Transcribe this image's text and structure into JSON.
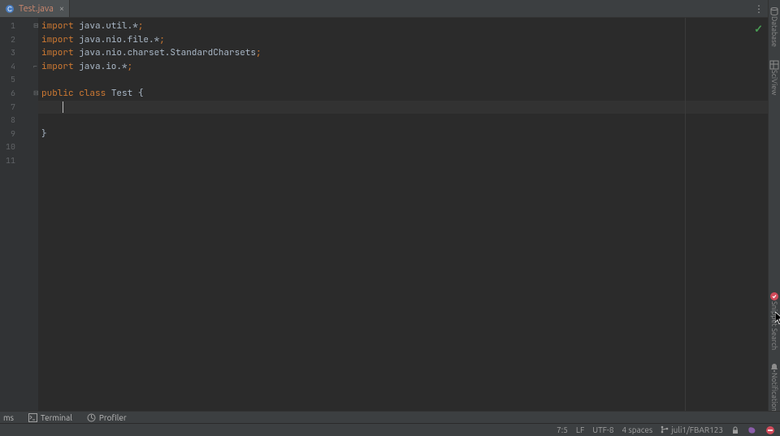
{
  "tab": {
    "filename": "Test.java",
    "close_glyph": "×"
  },
  "editor": {
    "line_numbers": [
      "1",
      "2",
      "3",
      "4",
      "5",
      "6",
      "7",
      "8",
      "9",
      "10",
      "11"
    ],
    "lines": [
      {
        "tokens": [
          {
            "t": "import ",
            "c": "kw"
          },
          {
            "t": "java.util.*",
            "c": "plain"
          },
          {
            "t": ";",
            "c": "semi"
          }
        ]
      },
      {
        "tokens": [
          {
            "t": "import ",
            "c": "kw"
          },
          {
            "t": "java.nio.file.*",
            "c": "plain"
          },
          {
            "t": ";",
            "c": "semi"
          }
        ]
      },
      {
        "tokens": [
          {
            "t": "import ",
            "c": "kw"
          },
          {
            "t": "java.nio.charset.StandardCharsets",
            "c": "plain"
          },
          {
            "t": ";",
            "c": "semi"
          }
        ]
      },
      {
        "tokens": [
          {
            "t": "import ",
            "c": "kw"
          },
          {
            "t": "java.io.*",
            "c": "plain"
          },
          {
            "t": ";",
            "c": "semi"
          }
        ]
      },
      {
        "tokens": [
          {
            "t": "",
            "c": "plain"
          }
        ]
      },
      {
        "tokens": [
          {
            "t": "public class ",
            "c": "kw"
          },
          {
            "t": "Test ",
            "c": "plain"
          },
          {
            "t": "{",
            "c": "plain"
          }
        ]
      },
      {
        "tokens": [
          {
            "t": "    ",
            "c": "plain"
          }
        ]
      },
      {
        "tokens": [
          {
            "t": "",
            "c": "plain"
          }
        ]
      },
      {
        "tokens": [
          {
            "t": "}",
            "c": "plain"
          }
        ]
      },
      {
        "tokens": [
          {
            "t": "",
            "c": "plain"
          }
        ]
      },
      {
        "tokens": [
          {
            "t": "",
            "c": "plain"
          }
        ]
      }
    ],
    "caret": {
      "line": 7,
      "col": 5
    }
  },
  "right_tools": [
    {
      "id": "database",
      "label": "Database"
    },
    {
      "id": "sciview",
      "label": "SciView"
    },
    {
      "id": "snippet-search",
      "label": "Snippet Search"
    },
    {
      "id": "notifications",
      "label": "Notifications"
    }
  ],
  "bottom_tools": [
    {
      "id": "problems",
      "label": "ms"
    },
    {
      "id": "terminal",
      "label": "Terminal"
    },
    {
      "id": "profiler",
      "label": "Profiler"
    }
  ],
  "status": {
    "cursor": "7:5",
    "line_sep": "LF",
    "encoding": "UTF-8",
    "indent": "4 spaces",
    "branch": "juli1/FBAR123"
  }
}
